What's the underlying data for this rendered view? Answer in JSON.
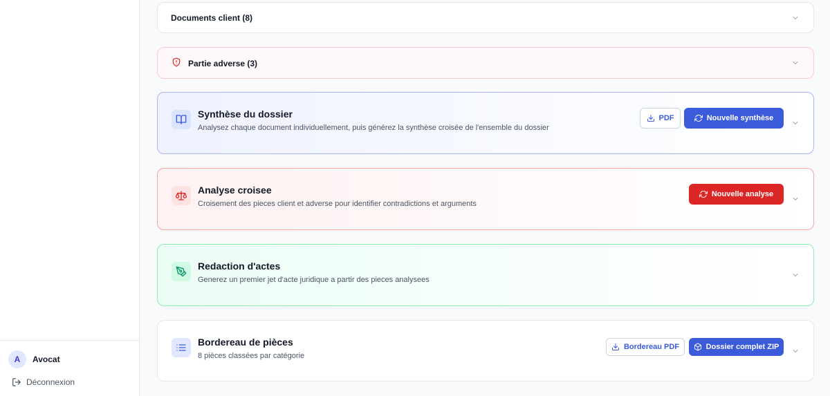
{
  "sidebar": {
    "user": {
      "avatar_initial": "A",
      "name": "Avocat"
    },
    "logout_label": "Déconnexion"
  },
  "sections": {
    "client_docs": {
      "title": "Documents client (8)"
    },
    "adverse": {
      "title": "Partie adverse (3)"
    },
    "synthese": {
      "title": "Synthèse du dossier",
      "subtitle": "Analysez chaque document individuellement, puis générez la synthèse croisée de l'ensemble du dossier",
      "pdf_label": "PDF",
      "action_label": "Nouvelle synthèse"
    },
    "analyse": {
      "title": "Analyse croisee",
      "subtitle": "Croisement des pieces client et adverse pour identifier contradictions et arguments",
      "action_label": "Nouvelle analyse"
    },
    "redaction": {
      "title": "Redaction d'actes",
      "subtitle": "Generez un premier jet d'acte juridique a partir des pieces analysees"
    },
    "bordereau": {
      "title": "Bordereau de pièces",
      "subtitle": "8 pièces classées par catégorie",
      "pdf_label": "Bordereau PDF",
      "zip_label": "Dossier complet ZIP"
    }
  },
  "colors": {
    "primary": "#3b5bdb",
    "danger": "#dc2626",
    "success": "#059669"
  }
}
